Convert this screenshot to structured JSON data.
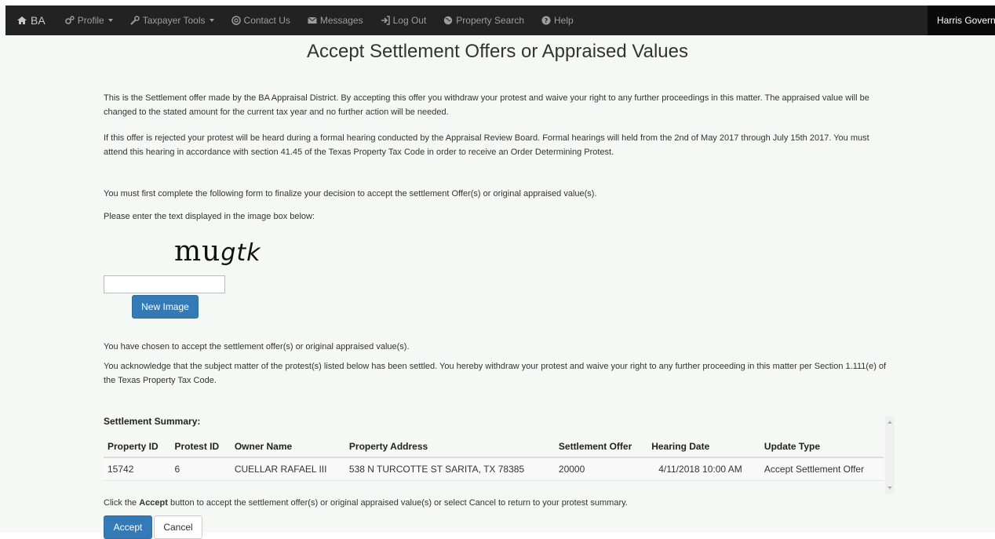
{
  "navbar": {
    "brand": "BA",
    "items": [
      {
        "label": "Profile",
        "icon": "cogs-icon",
        "dropdown": true
      },
      {
        "label": "Taxpayer Tools",
        "icon": "wrench-icon",
        "dropdown": true
      },
      {
        "label": "Contact Us",
        "icon": "lifesaver-icon",
        "dropdown": false
      },
      {
        "label": "Messages",
        "icon": "envelope-icon",
        "dropdown": false
      },
      {
        "label": "Log Out",
        "icon": "logout-icon",
        "dropdown": false
      },
      {
        "label": "Property Search",
        "icon": "globe-icon",
        "dropdown": false
      },
      {
        "label": "Help",
        "icon": "question-icon",
        "dropdown": false
      }
    ],
    "right_label": "Harris Govern"
  },
  "page": {
    "title": "Accept Settlement Offers or Appraised Values",
    "para1": "This is the Settlement offer made by the BA Appraisal District. By accepting this offer you withdraw your protest and waive your right to any further proceedings in this matter. The appraised value will be changed to the stated amount for the current tax year and no further action will be needed.",
    "para2": "If this offer is rejected your protest will be heard during a formal hearing conducted by the Appraisal Review Board. Formal hearings will held from the 2nd of May 2017 through July 15th 2017. You must attend this hearing in accordance with section 41.45 of the Texas Property Tax Code in order to receive an Order Determining Protest.",
    "para3": "You must first complete the following form to finalize your decision to accept the settlement Offer(s) or original appraised value(s).",
    "captcha_prompt": "Please enter the text displayed in the image box below:",
    "captcha_text_a": "mu",
    "captcha_text_b": "gtk",
    "captcha_value": "",
    "new_image_label": "New Image",
    "chosen_text": "You have chosen to accept the settlement offer(s) or original appraised value(s).",
    "acknowledge_text": "You acknowledge that the subject matter of the protest(s) listed below has been settled. You hereby withdraw your protest and waive your right to any further proceeding in this matter per Section 1.111(e) of the Texas Property Tax Code.",
    "instruction_pre": "Click the ",
    "instruction_bold": "Accept",
    "instruction_post": " button to accept the settlement offer(s) or original appraised value(s) or select Cancel to return to your protest summary.",
    "accept_label": "Accept",
    "cancel_label": "Cancel"
  },
  "summary": {
    "heading": "Settlement Summary:",
    "columns": [
      "Property ID",
      "Protest ID",
      "Owner Name",
      "Property Address",
      "Settlement Offer",
      "Hearing Date",
      "Update Type"
    ],
    "rows": [
      [
        "15742",
        "6",
        "CUELLAR RAFAEL III",
        "538 N TURCOTTE ST SARITA, TX 78385",
        "20000",
        "4/11/2018 10:00 AM",
        "Accept Settlement Offer"
      ]
    ]
  }
}
